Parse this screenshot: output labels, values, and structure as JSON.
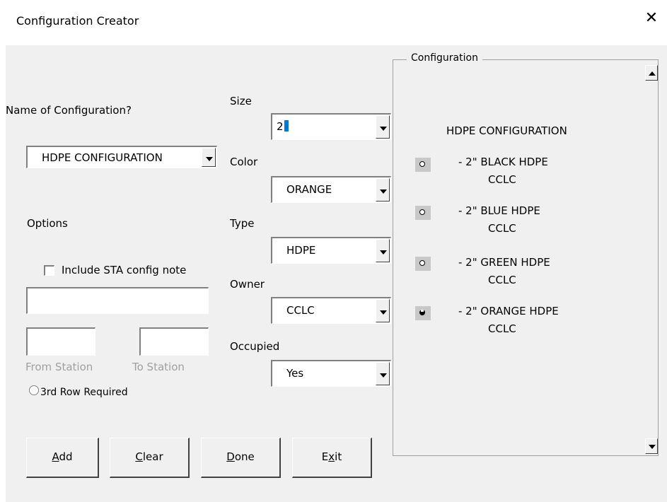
{
  "window": {
    "title": "Configuration Creator",
    "close_glyph": "✕"
  },
  "name_section": {
    "label": "Name of Configuration?",
    "value": "HDPE CONFIGURATION"
  },
  "options": {
    "label": "Options",
    "include_sta_label": "Include STA config note",
    "include_sta_checked": false,
    "from_station_label": "From Station",
    "to_station_label": "To Station",
    "third_row_label": "3rd Row Required"
  },
  "fields": {
    "size": {
      "label": "Size",
      "value": "2"
    },
    "color": {
      "label": "Color",
      "value": "ORANGE"
    },
    "type": {
      "label": "Type",
      "value": "HDPE"
    },
    "owner": {
      "label": "Owner",
      "value": "CCLC"
    },
    "occupied": {
      "label": "Occupied",
      "value": "Yes"
    }
  },
  "buttons": {
    "add": {
      "pre": "",
      "mnemonic": "A",
      "post": "dd"
    },
    "clear": {
      "pre": "",
      "mnemonic": "C",
      "post": "lear"
    },
    "done": {
      "pre": "",
      "mnemonic": "D",
      "post": "one"
    },
    "exit": {
      "pre": "E",
      "mnemonic": "x",
      "post": "it"
    }
  },
  "configuration": {
    "frame_label": "Configuration",
    "heading": "HDPE CONFIGURATION",
    "items": [
      {
        "line1": "- 2\" BLACK HDPE",
        "line2": "CCLC",
        "selected": false
      },
      {
        "line1": "- 2\" BLUE HDPE",
        "line2": "CCLC",
        "selected": false
      },
      {
        "line1": "- 2\" GREEN HDPE",
        "line2": "CCLC",
        "selected": false
      },
      {
        "line1": "- 2\" ORANGE HDPE",
        "line2": "CCLC",
        "selected": true
      }
    ]
  }
}
